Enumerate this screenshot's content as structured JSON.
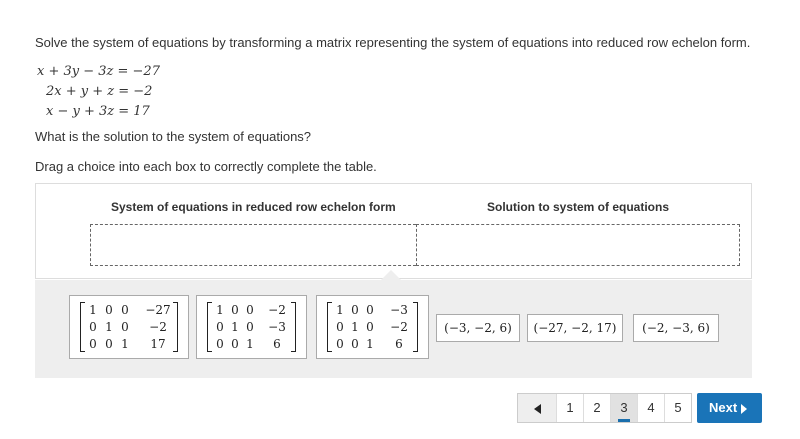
{
  "prompt": "Solve the system of equations by transforming a matrix representing the system of equations into reduced row echelon form.",
  "equations": [
    "x + 3y − 3z = −27",
    "2x + y + z = −2",
    "x − y + 3z = 17"
  ],
  "question": "What is the solution to the system of equations?",
  "instruction": "Drag a choice into each box to correctly complete the table.",
  "table": {
    "headers": [
      "System of equations in reduced row echelon form",
      "Solution to system of equations"
    ]
  },
  "choices": {
    "matrices": [
      [
        [
          "1",
          "0",
          "0",
          "−27"
        ],
        [
          "0",
          "1",
          "0",
          "−2"
        ],
        [
          "0",
          "0",
          "1",
          "17"
        ]
      ],
      [
        [
          "1",
          "0",
          "0",
          "−2"
        ],
        [
          "0",
          "1",
          "0",
          "−3"
        ],
        [
          "0",
          "0",
          "1",
          "6"
        ]
      ],
      [
        [
          "1",
          "0",
          "0",
          "−3"
        ],
        [
          "0",
          "1",
          "0",
          "−2"
        ],
        [
          "0",
          "0",
          "1",
          "6"
        ]
      ]
    ],
    "tuples": [
      "(−3, −2, 6)",
      "(−27, −2, 17)",
      "(−2, −3, 6)"
    ]
  },
  "pager": {
    "pages": [
      "1",
      "2",
      "3",
      "4",
      "5"
    ],
    "active_page": "3",
    "next_label": "Next"
  },
  "icons": {
    "prev": "triangle-left-icon",
    "next": "triangle-right-icon"
  },
  "colors": {
    "next_button": "#1a74b8",
    "choice_tray": "#eeeeee"
  }
}
